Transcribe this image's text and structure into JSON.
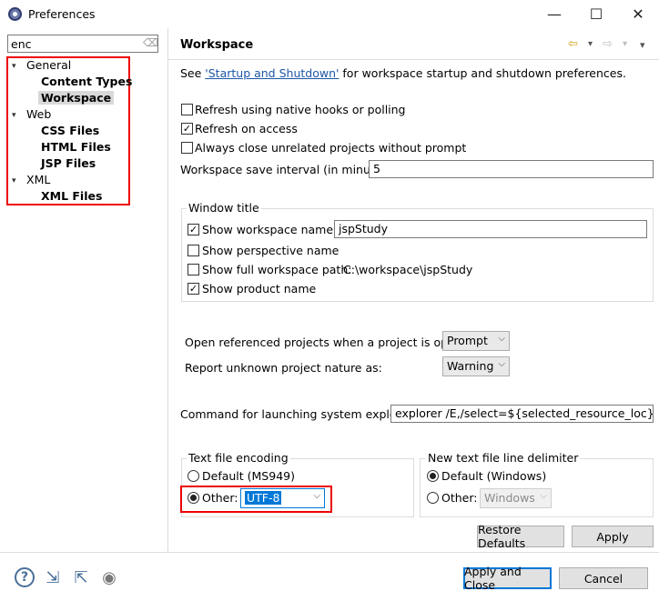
{
  "window": {
    "title": "Preferences",
    "controls": {
      "minimize": "—",
      "maximize": "☐",
      "close": "✕"
    }
  },
  "filter": {
    "value": "enc"
  },
  "tree": {
    "general": "General",
    "content_types": "Content Types",
    "workspace": "Workspace",
    "web": "Web",
    "css_files": "CSS Files",
    "html_files": "HTML Files",
    "jsp_files": "JSP Files",
    "xml": "XML",
    "xml_files": "XML Files"
  },
  "page": {
    "title": "Workspace",
    "see_prefix": "See ",
    "see_link": "'Startup and Shutdown'",
    "see_suffix": " for workspace startup and shutdown preferences.",
    "refresh_native": "Refresh using native hooks or polling",
    "refresh_access": "Refresh on access",
    "always_close": "Always close unrelated projects without prompt",
    "save_interval_label": "Workspace save interval (in minutes):",
    "save_interval_value": "5",
    "window_title_group": "Window title",
    "show_ws_name": "Show workspace name:",
    "ws_name_value": "jspStudy",
    "show_perspective": "Show perspective name",
    "show_full_path": "Show full workspace path:",
    "full_path_value": "C:\\workspace\\jspStudy",
    "show_product": "Show product name",
    "open_ref_label": "Open referenced projects when a project is opened:",
    "open_ref_value": "Prompt",
    "report_unknown_label": "Report unknown project nature as:",
    "report_unknown_value": "Warning",
    "cmd_label": "Command for launching system explorer:",
    "cmd_value": "explorer /E,/select=${selected_resource_loc}",
    "encoding_group": "Text file encoding",
    "enc_default": "Default (MS949)",
    "enc_other": "Other:",
    "enc_other_value": "UTF-8",
    "delim_group": "New text file line delimiter",
    "delim_default": "Default (Windows)",
    "delim_other": "Other:",
    "delim_other_value": "Windows"
  },
  "buttons": {
    "restore_defaults": "Restore Defaults",
    "apply": "Apply",
    "apply_close": "Apply and Close",
    "cancel": "Cancel"
  },
  "icons": {
    "help": "?",
    "import": "⇲",
    "export": "⇱",
    "oomph": "◉",
    "back": "⇦",
    "forward": "⇨",
    "dropdown": "▾",
    "menu": "▾",
    "check": "✓",
    "expanded": "▾",
    "eraser": "⌫"
  }
}
